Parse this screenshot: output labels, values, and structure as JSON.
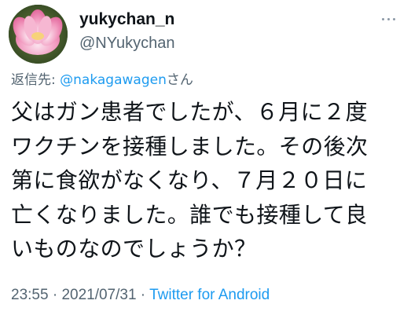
{
  "user": {
    "display_name": "yukychan_n",
    "handle": "@NYukychan"
  },
  "reply": {
    "prefix": "返信先: ",
    "mention": "@nakagawagen",
    "suffix": "さん"
  },
  "tweet": {
    "lines": [
      "父はガン患者でしたが、６月に２度",
      "ワクチンを接種しました。その後次",
      "第に食欲がなくなり、７月２０日に",
      "亡くなりました。誰でも接種して良",
      "いものなのでしょうか？"
    ]
  },
  "meta": {
    "time": "23:55",
    "separator1": " · ",
    "date": "2021/07/31",
    "separator2": " · ",
    "source": "Twitter for Android"
  },
  "icons": {
    "avatar": "lotus-flower-avatar",
    "more": "more-options-icon"
  },
  "colors": {
    "text": "#0f1419",
    "secondary": "#536471",
    "accent": "#1d9bf0"
  }
}
